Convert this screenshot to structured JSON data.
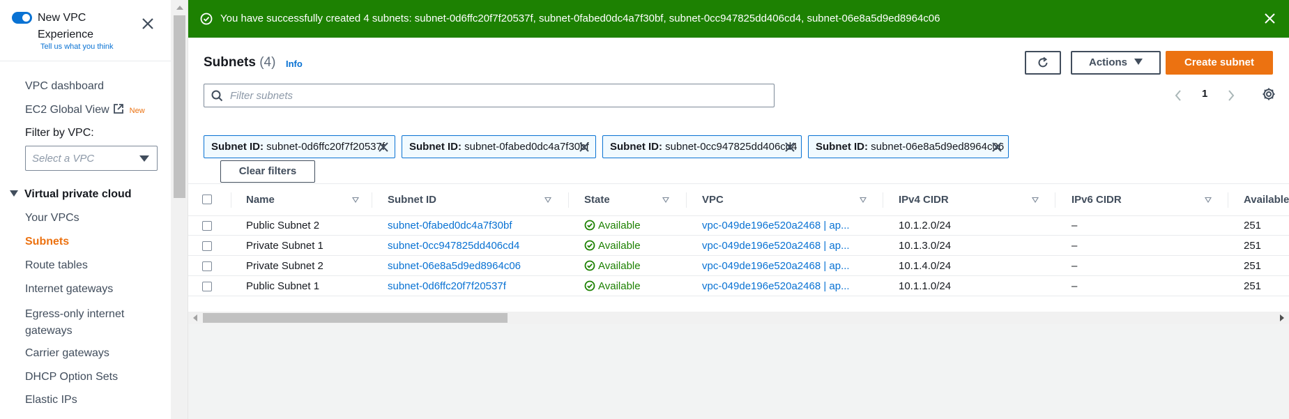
{
  "sidebar": {
    "experience_title": "New VPC Experience",
    "experience_link": "Tell us what you think",
    "nav_top": [
      {
        "label": "VPC dashboard"
      },
      {
        "label": "EC2 Global View",
        "badge": "New"
      }
    ],
    "filter_label": "Filter by VPC:",
    "filter_placeholder": "Select a VPC",
    "section_title": "Virtual private cloud",
    "section_items": [
      {
        "label": "Your VPCs"
      },
      {
        "label": "Subnets",
        "active": true
      },
      {
        "label": "Route tables"
      },
      {
        "label": "Internet gateways"
      },
      {
        "label": "Egress-only internet gateways"
      },
      {
        "label": "Carrier gateways"
      },
      {
        "label": "DHCP Option Sets"
      },
      {
        "label": "Elastic IPs"
      }
    ]
  },
  "flash": {
    "message": "You have successfully created 4 subnets: subnet-0d6ffc20f7f20537f, subnet-0fabed0dc4a7f30bf, subnet-0cc947825dd406cd4, subnet-06e8a5d9ed8964c06",
    "color": "#1d8102"
  },
  "header": {
    "title": "Subnets",
    "count": "(4)",
    "info": "Info",
    "actions_label": "Actions",
    "create_label": "Create subnet"
  },
  "search": {
    "placeholder": "Filter subnets"
  },
  "pagination": {
    "current_page": "1"
  },
  "filter_tokens": [
    {
      "key": "Subnet ID:",
      "value": "subnet-0d6ffc20f7f20537f"
    },
    {
      "key": "Subnet ID:",
      "value": "subnet-0fabed0dc4a7f30bf"
    },
    {
      "key": "Subnet ID:",
      "value": "subnet-0cc947825dd406cd4"
    },
    {
      "key": "Subnet ID:",
      "value": "subnet-06e8a5d9ed8964c06"
    }
  ],
  "clear_filters_label": "Clear filters",
  "table": {
    "columns": [
      "Name",
      "Subnet ID",
      "State",
      "VPC",
      "IPv4 CIDR",
      "IPv6 CIDR",
      "Available"
    ],
    "rows": [
      {
        "name": "Public Subnet 2",
        "subnet_id": "subnet-0fabed0dc4a7f30bf",
        "state": "Available",
        "vpc": "vpc-049de196e520a2468 | ap...",
        "ipv4": "10.1.2.0/24",
        "ipv6": "–",
        "available": "251"
      },
      {
        "name": "Private Subnet 1",
        "subnet_id": "subnet-0cc947825dd406cd4",
        "state": "Available",
        "vpc": "vpc-049de196e520a2468 | ap...",
        "ipv4": "10.1.3.0/24",
        "ipv6": "–",
        "available": "251"
      },
      {
        "name": "Private Subnet 2",
        "subnet_id": "subnet-06e8a5d9ed8964c06",
        "state": "Available",
        "vpc": "vpc-049de196e520a2468 | ap...",
        "ipv4": "10.1.4.0/24",
        "ipv6": "–",
        "available": "251"
      },
      {
        "name": "Public Subnet 1",
        "subnet_id": "subnet-0d6ffc20f7f20537f",
        "state": "Available",
        "vpc": "vpc-049de196e520a2468 | ap...",
        "ipv4": "10.1.1.0/24",
        "ipv6": "–",
        "available": "251"
      }
    ]
  },
  "colors": {
    "accent": "#ec7211",
    "link": "#0972d3",
    "success": "#1d8102"
  },
  "icons": [
    "toggle-icon",
    "close-icon",
    "external-link-icon",
    "success-icon",
    "refresh-icon",
    "search-icon",
    "settings-icon",
    "status-ok-icon"
  ]
}
